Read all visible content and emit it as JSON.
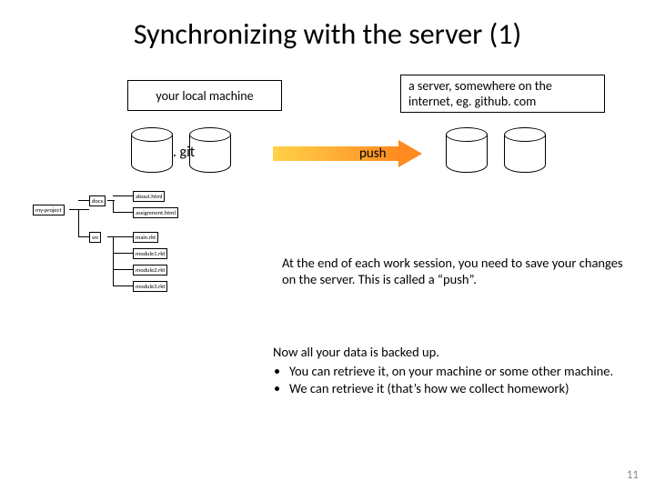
{
  "title": "Synchronizing with the server (1)",
  "local_label": "your local machine",
  "server_label": "a server, somewhere on the internet, eg. github. com",
  "git_label": ". git",
  "push_label": "push",
  "tree": {
    "root": "my-project",
    "dirs": {
      "docs": "docs",
      "src": "src"
    },
    "files": {
      "about": "about.html",
      "assign": "assignment.html",
      "main": "main.rkt",
      "m1": "module1.rkt",
      "m2": "module2.rkt",
      "m3": "module3.rkt"
    }
  },
  "para1": "At the end of each work session, you need to save your changes on the server.  This is called a “push”.",
  "para2_intro": "Now all your data is backed up.",
  "para2_b1": "You can retrieve it, on your machine or some other machine.",
  "para2_b2": "We can retrieve it (that’s how we collect homework)",
  "page": "11"
}
